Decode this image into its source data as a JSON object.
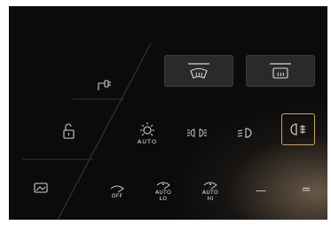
{
  "lighting": {
    "auto_label": "AUTO"
  },
  "wipers": {
    "off_label": "OFF",
    "auto_lo_line1": "AUTO",
    "auto_lo_line2": "LO",
    "auto_hi_line1": "AUTO",
    "auto_hi_line2": "HI",
    "dash_low": "—",
    "dash_high": "="
  },
  "icons": {
    "charge_port": "charge-port-icon",
    "trunk": "trunk-unlock-icon",
    "mirror": "mirror-fold-icon",
    "front_defrost": "front-defrost-icon",
    "rear_defrost": "rear-defrost-icon",
    "auto_headlights": "auto-headlight-sun-icon",
    "parking_lights": "parking-lights-icon",
    "low_beam": "low-beam-icon",
    "fog_light": "fog-light-icon"
  },
  "colors": {
    "accent": "#c9a46a",
    "panel": "#2a2a2a",
    "text": "#e6e6e6"
  }
}
